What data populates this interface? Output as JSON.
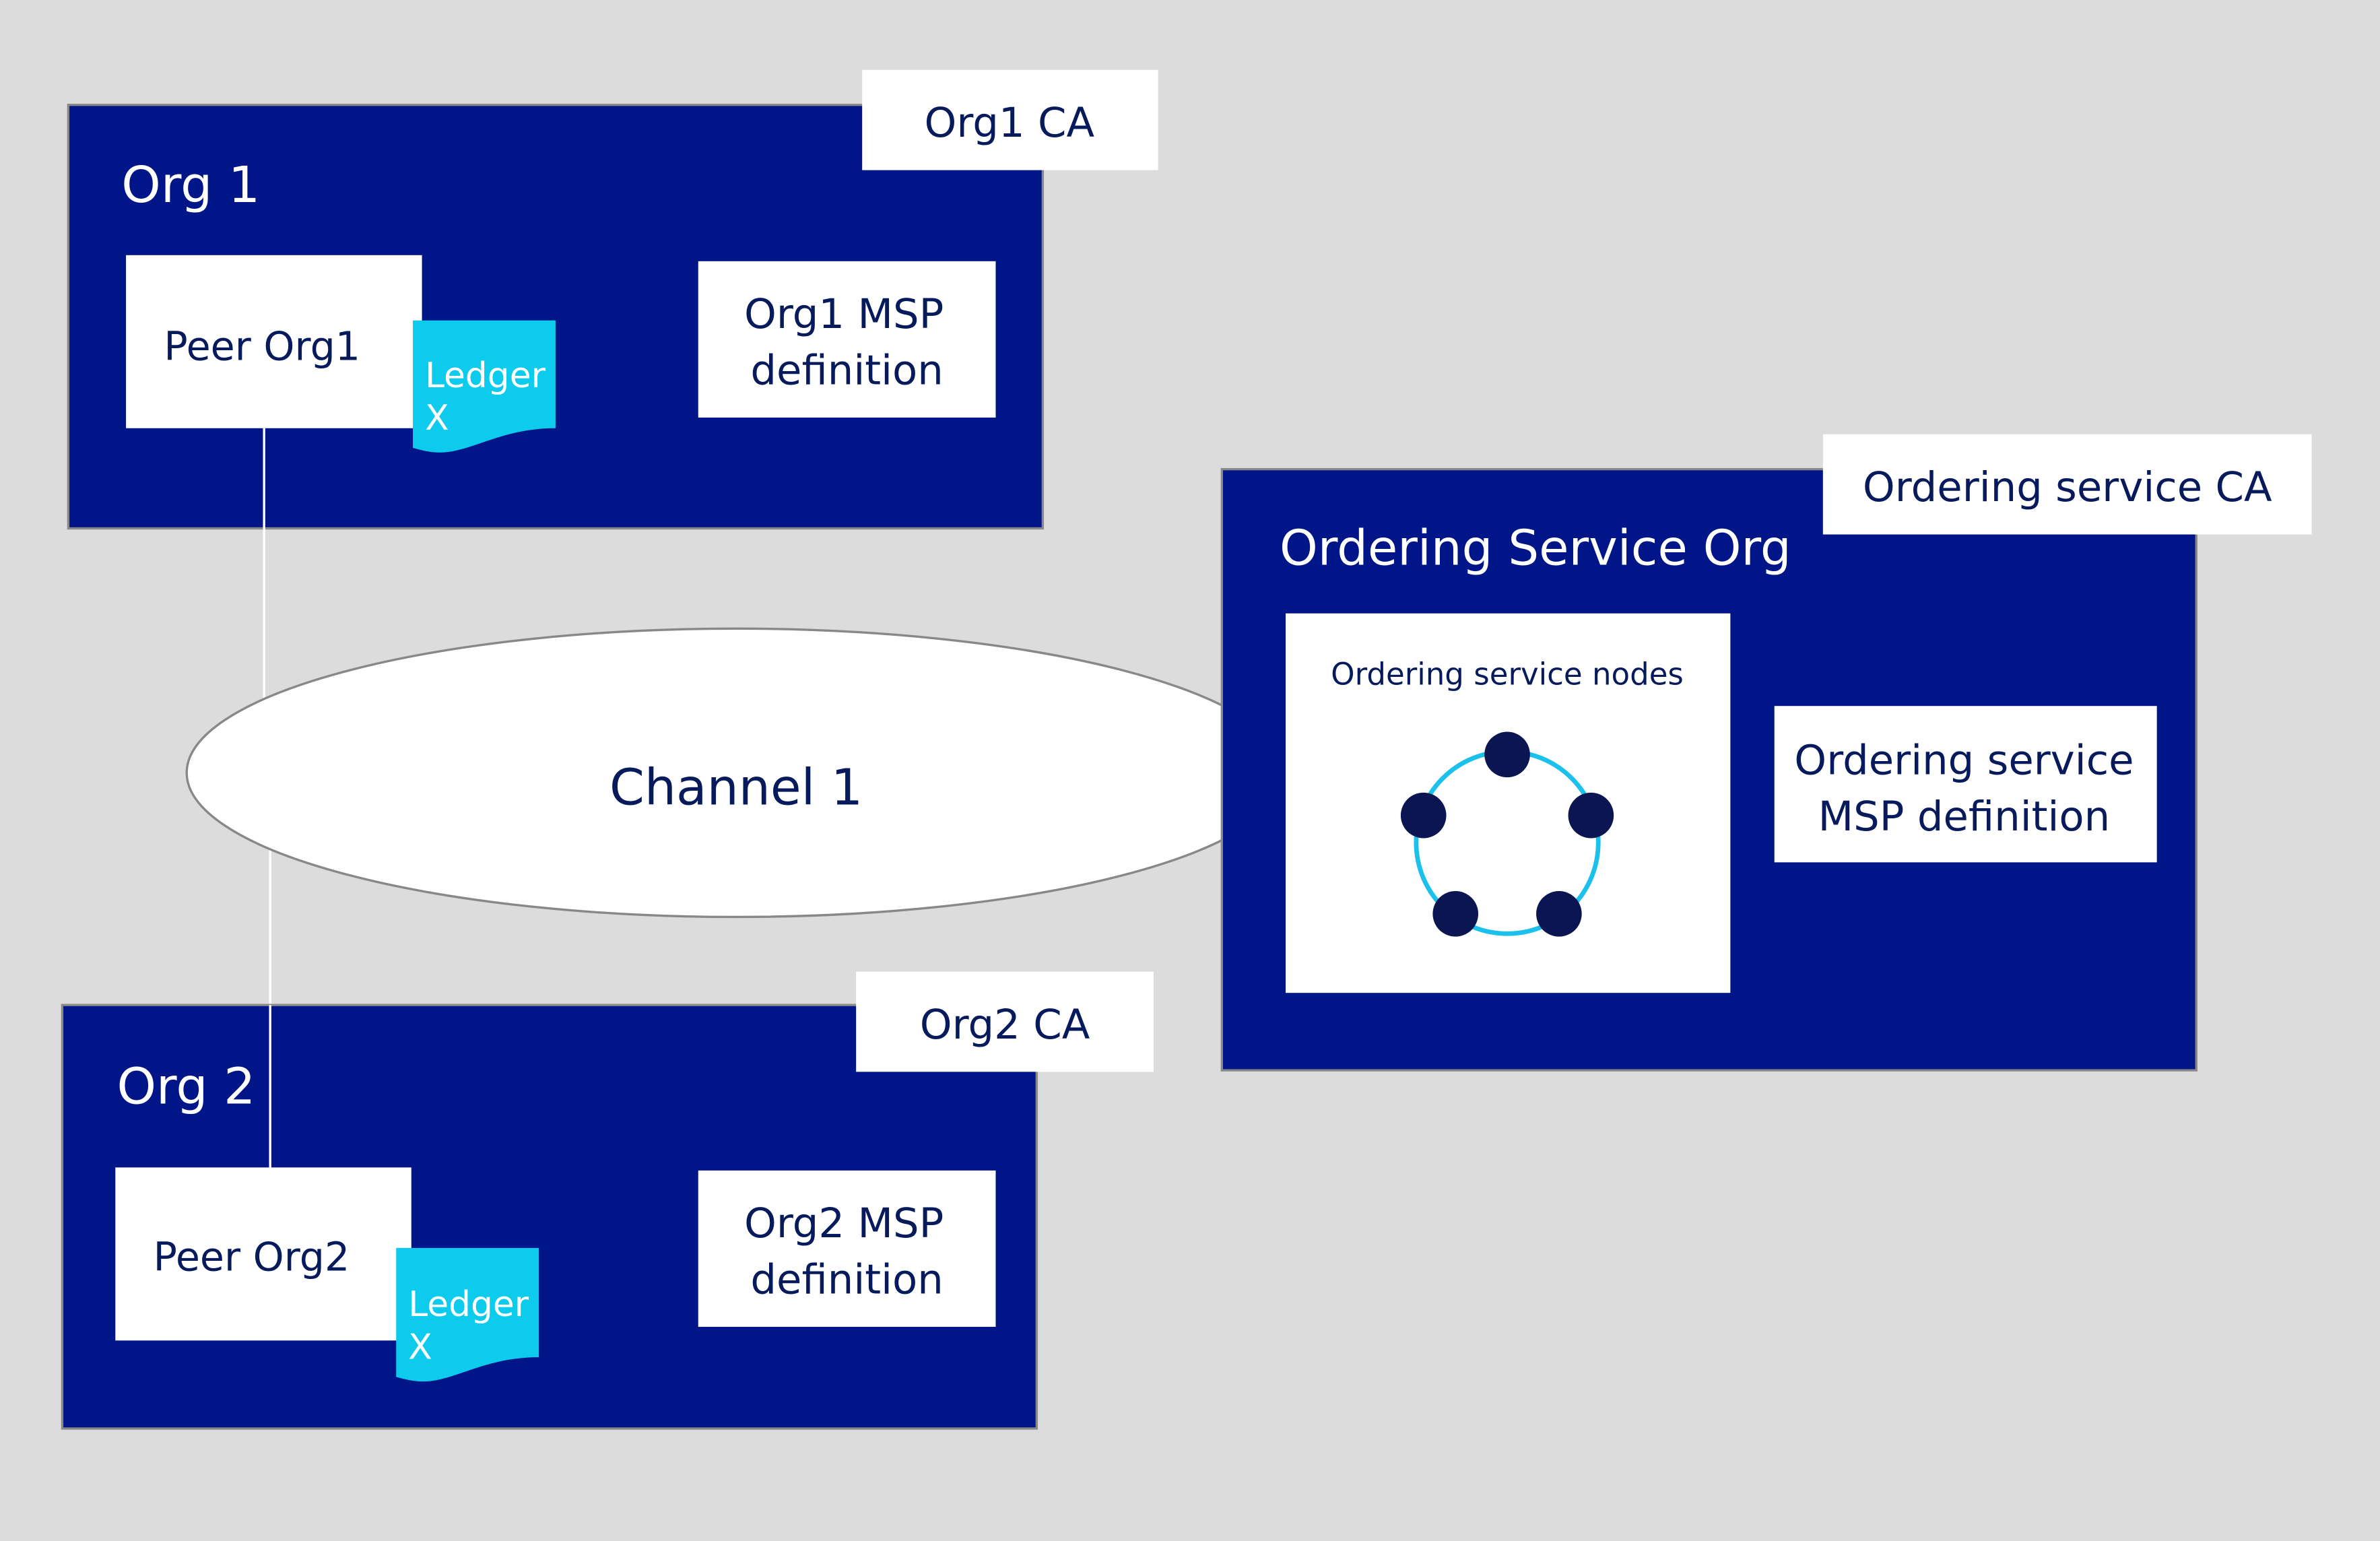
{
  "colors": {
    "background": "#dcdcdc",
    "org_box": "#001587",
    "ledger": "#0ccbec",
    "dark_text": "#061a5c",
    "node": "#0a1551",
    "ring": "#1cc0ec"
  },
  "org1": {
    "title": "Org 1",
    "ca": "Org1 CA",
    "peer": "Peer Org1",
    "ledger_line1": "Ledger",
    "ledger_line2": "X",
    "msp_line1": "Org1 MSP",
    "msp_line2": "definition"
  },
  "org2": {
    "title": "Org 2",
    "ca": "Org2 CA",
    "peer": "Peer Org2",
    "ledger_line1": "Ledger",
    "ledger_line2": "X",
    "msp_line1": "Org2 MSP",
    "msp_line2": "definition"
  },
  "channel": {
    "label": "Channel 1"
  },
  "ordering": {
    "title": "Ordering Service Org",
    "ca": "Ordering service CA",
    "nodes_label": "Ordering service nodes",
    "node_count": 5,
    "msp_line1": "Ordering service",
    "msp_line2": "MSP definition"
  }
}
